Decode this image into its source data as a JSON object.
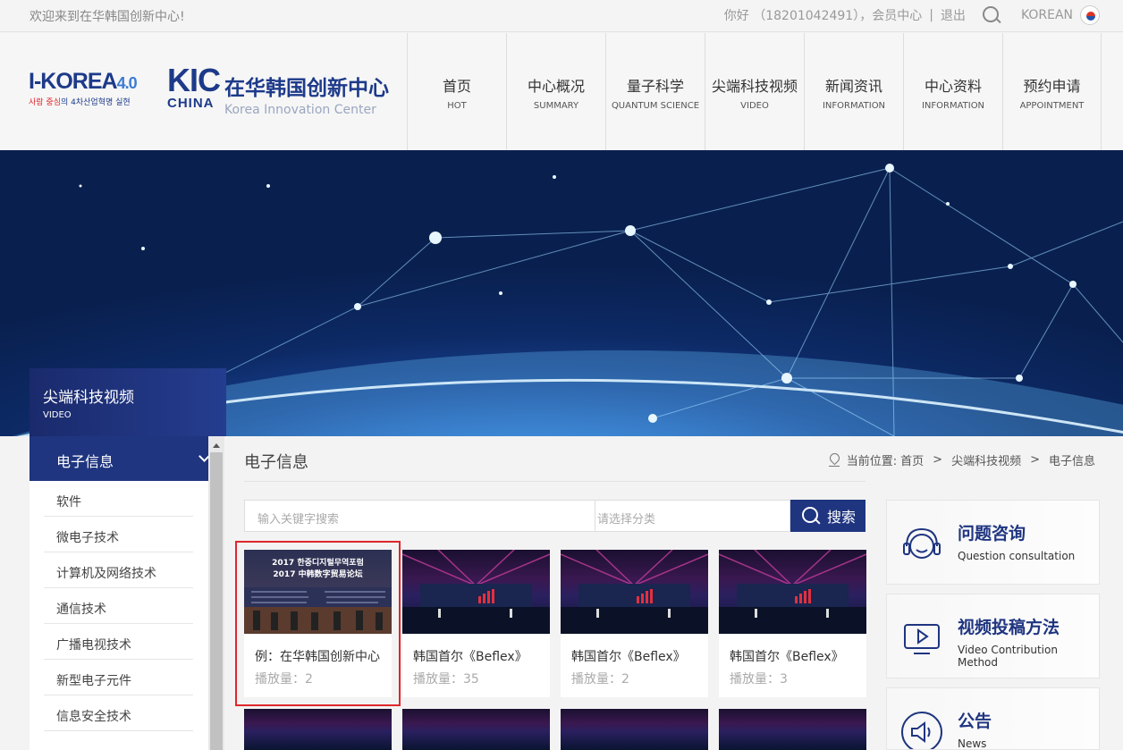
{
  "topbar": {
    "welcome": "欢迎来到在华韩国创新中心!",
    "greeting": "你好 （18201042491），会员中心",
    "divider": "|",
    "logout": "退出",
    "language": "KOREAN"
  },
  "logos": {
    "ikorea_main": "I-KOREA",
    "ikorea_version": "4.0",
    "ikorea_tag_red": "사람 중심",
    "ikorea_tag_rest": "의 4차산업혁명 실현",
    "kic_top": "KIC",
    "kic_bottom": "CHINA",
    "center_name": "在华韩国创新中心",
    "center_en": "Korea Innovation Center"
  },
  "nav": [
    {
      "zh": "首页",
      "en": "HOT"
    },
    {
      "zh": "中心概况",
      "en": "SUMMARY"
    },
    {
      "zh": "量子科学",
      "en": "QUANTUM SCIENCE"
    },
    {
      "zh": "尖端科技视频",
      "en": "VIDEO"
    },
    {
      "zh": "新闻资讯",
      "en": "INFORMATION"
    },
    {
      "zh": "中心资料",
      "en": "INFORMATION"
    },
    {
      "zh": "预约申请",
      "en": "APPOINTMENT"
    }
  ],
  "section": {
    "title": "尖端科技视频",
    "subtitle": "VIDEO"
  },
  "sidebar": {
    "active": "电子信息",
    "items": [
      "软件",
      "微电子技术",
      "计算机及网络技术",
      "通信技术",
      "广播电视技术",
      "新型电子元件",
      "信息安全技术"
    ]
  },
  "main": {
    "title": "电子信息",
    "breadcrumb": {
      "label": "当前位置:",
      "home": "首页",
      "sep": ">",
      "level1": "尖端科技视频",
      "level2": "电子信息"
    }
  },
  "search": {
    "keyword_placeholder": "输入关键字搜索",
    "category_placeholder": "请选择分类",
    "button": "搜索"
  },
  "videos": [
    {
      "title": "例：在华韩国创新中心",
      "plays": "播放量：2",
      "thumb_line1": "2017 한중디지털무역포럼",
      "thumb_line2": "2017 中韩数字贸易论坛"
    },
    {
      "title": "韩国首尔《Beflex》",
      "plays": "播放量：35"
    },
    {
      "title": "韩国首尔《Beflex》",
      "plays": "播放量：2"
    },
    {
      "title": "韩国首尔《Beflex》",
      "plays": "播放量：3"
    }
  ],
  "right_panel": [
    {
      "zh": "问题咨询",
      "en": "Question consultation",
      "icon": "headset-icon"
    },
    {
      "zh": "视频投稿方法",
      "en": "Video Contribution Method",
      "icon": "video-play-icon"
    },
    {
      "zh": "公告",
      "en": "News",
      "icon": "megaphone-icon"
    }
  ],
  "colors": {
    "brand_navy": "#1f3580",
    "accent_red": "#e0262b"
  }
}
